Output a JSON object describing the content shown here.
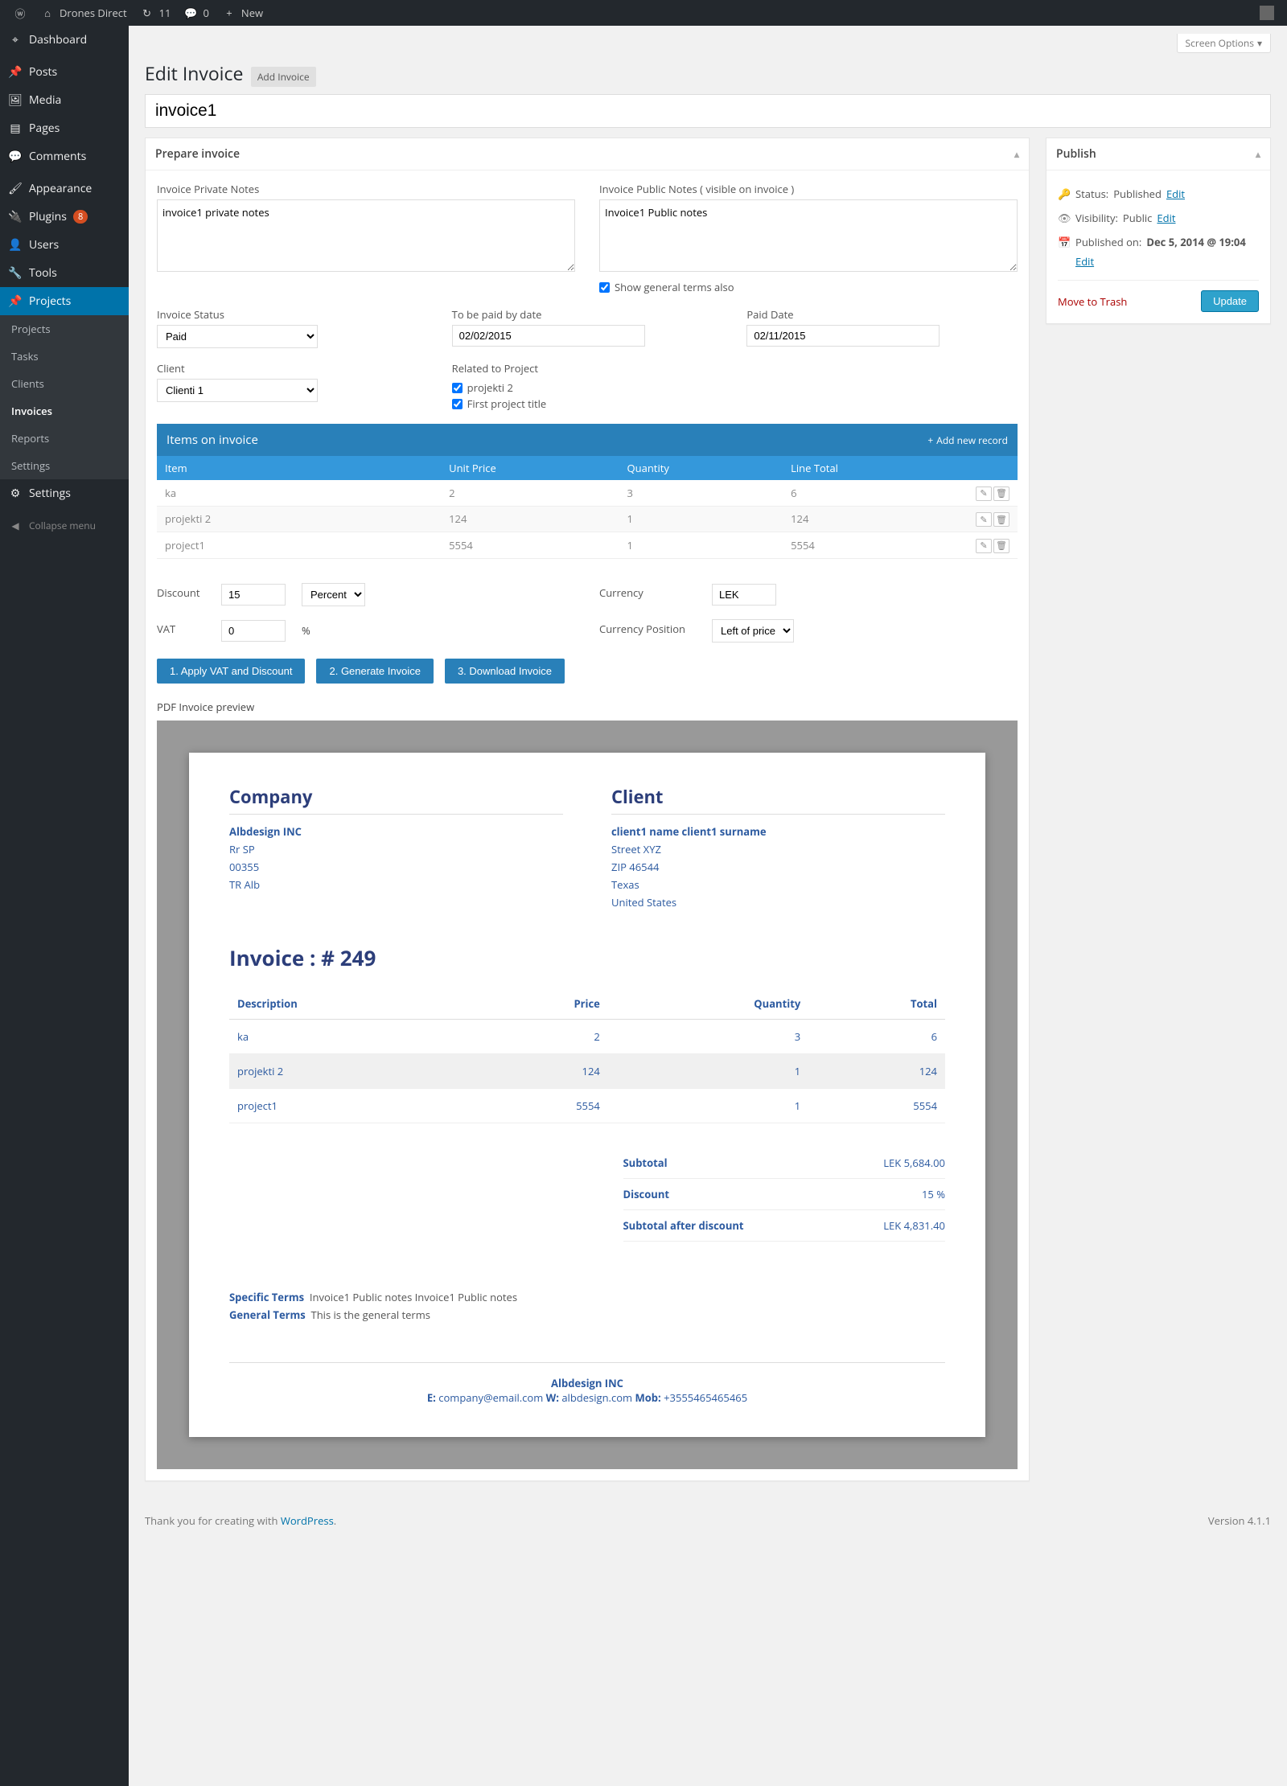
{
  "adminbar": {
    "site_name": "Drones Direct",
    "updates": "11",
    "comments": "0",
    "new": "New"
  },
  "sidebar": {
    "dashboard": "Dashboard",
    "posts": "Posts",
    "media": "Media",
    "pages": "Pages",
    "comments": "Comments",
    "appearance": "Appearance",
    "plugins": "Plugins",
    "plugins_count": "8",
    "users": "Users",
    "tools": "Tools",
    "projects": "Projects",
    "sub_projects": "Projects",
    "sub_tasks": "Tasks",
    "sub_clients": "Clients",
    "sub_invoices": "Invoices",
    "sub_reports": "Reports",
    "sub_settings": "Settings",
    "settings": "Settings",
    "collapse": "Collapse menu"
  },
  "page": {
    "screen_options": "Screen Options",
    "title": "Edit Invoice",
    "add_new": "Add Invoice",
    "post_title": "invoice1"
  },
  "metabox": {
    "prepare_title": "Prepare invoice",
    "private_notes_label": "Invoice Private Notes",
    "private_notes_value": "invoice1 private notes",
    "public_notes_label": "Invoice Public Notes ( visible on invoice )",
    "public_notes_value": "Invoice1 Public notes",
    "show_terms": "Show general terms also",
    "status_label": "Invoice Status",
    "status_value": "Paid",
    "pay_by_label": "To be paid by date",
    "pay_by_value": "02/02/2015",
    "paid_date_label": "Paid Date",
    "paid_date_value": "02/11/2015",
    "client_label": "Client",
    "client_value": "Clienti 1",
    "related_label": "Related to Project",
    "related_1": "projekti 2",
    "related_2": "First project title"
  },
  "items_table": {
    "title": "Items on invoice",
    "add_new": "Add new record",
    "col_item": "Item",
    "col_price": "Unit Price",
    "col_qty": "Quantity",
    "col_total": "Line Total",
    "rows": [
      {
        "item": "ka",
        "price": "2",
        "qty": "3",
        "total": "6"
      },
      {
        "item": "projekti 2",
        "price": "124",
        "qty": "1",
        "total": "124"
      },
      {
        "item": "project1",
        "price": "5554",
        "qty": "1",
        "total": "5554"
      }
    ]
  },
  "calc": {
    "discount_label": "Discount",
    "discount_value": "15",
    "discount_type": "Percent",
    "vat_label": "VAT",
    "vat_value": "0",
    "vat_unit": "%",
    "currency_label": "Currency",
    "currency_value": "LEK",
    "currency_pos_label": "Currency Position",
    "currency_pos_value": "Left of price"
  },
  "buttons": {
    "apply": "1. Apply VAT and Discount",
    "generate": "2. Generate Invoice",
    "download": "3. Download Invoice"
  },
  "preview": {
    "label": "PDF Invoice preview",
    "company_heading": "Company",
    "company_name": "Albdesign INC",
    "company_l1": "Rr SP",
    "company_l2": "00355",
    "company_l3": "TR Alb",
    "client_heading": "Client",
    "client_name": "client1 name client1 surname",
    "client_l1": "Street XYZ",
    "client_l2": "ZIP 46544",
    "client_l3": "Texas",
    "client_l4": "United States",
    "invoice_no": "Invoice : # 249",
    "th_desc": "Description",
    "th_price": "Price",
    "th_qty": "Quantity",
    "th_total": "Total",
    "rows": [
      {
        "d": "ka",
        "p": "2",
        "q": "3",
        "t": "6"
      },
      {
        "d": "projekti 2",
        "p": "124",
        "q": "1",
        "t": "124"
      },
      {
        "d": "project1",
        "p": "5554",
        "q": "1",
        "t": "5554"
      }
    ],
    "subtotal_label": "Subtotal",
    "subtotal_value": "LEK 5,684.00",
    "discount_label": "Discount",
    "discount_value": "15 %",
    "after_label": "Subtotal after discount",
    "after_value": "LEK 4,831.40",
    "specific_terms_label": "Specific Terms",
    "specific_terms_value": "Invoice1 Public notes Invoice1 Public notes",
    "general_terms_label": "General Terms",
    "general_terms_value": "This is the general terms",
    "footer_name": "Albdesign INC",
    "footer_email_label": "E:",
    "footer_email": "company@email.com",
    "footer_web_label": "W:",
    "footer_web": "albdesign.com",
    "footer_mob_label": "Mob:",
    "footer_mob": "+3555465465465"
  },
  "publish": {
    "title": "Publish",
    "status_label": "Status:",
    "status_value": "Published",
    "visibility_label": "Visibility:",
    "visibility_value": "Public",
    "published_label": "Published on:",
    "published_value": "Dec 5, 2014 @ 19:04",
    "edit": "Edit",
    "trash": "Move to Trash",
    "update": "Update"
  },
  "footer": {
    "thank": "Thank you for creating with ",
    "wp": "WordPress",
    "version": "Version 4.1.1"
  }
}
